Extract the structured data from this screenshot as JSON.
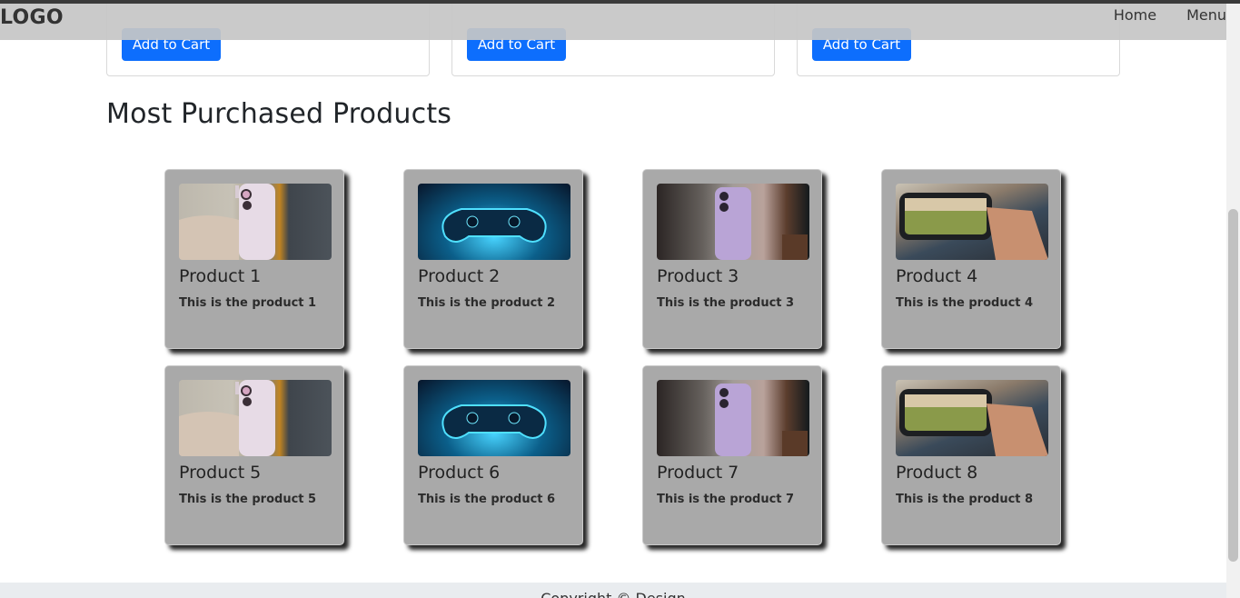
{
  "navbar": {
    "logo": "LOGO",
    "links": [
      "Home",
      "Menu"
    ]
  },
  "previous_cards": {
    "button_label": "Add to Cart"
  },
  "section": {
    "title": "Most Purchased Products"
  },
  "products": [
    {
      "name": "Product 1",
      "description": "This is the product 1",
      "image": "phone-hand-image"
    },
    {
      "name": "Product 2",
      "description": "This is the product 2",
      "image": "gamepad-image"
    },
    {
      "name": "Product 3",
      "description": "This is the product 3",
      "image": "phone-desk-image"
    },
    {
      "name": "Product 4",
      "description": "This is the product 4",
      "image": "phone-camera-landscape-image"
    },
    {
      "name": "Product 5",
      "description": "This is the product 5",
      "image": "phone-hand-image"
    },
    {
      "name": "Product 6",
      "description": "This is the product 6",
      "image": "gamepad-image"
    },
    {
      "name": "Product 7",
      "description": "This is the product 7",
      "image": "phone-desk-image"
    },
    {
      "name": "Product 8",
      "description": "This is the product 8",
      "image": "phone-camera-landscape-image"
    }
  ],
  "footer": {
    "text": "Copyright © Design"
  },
  "colors": {
    "accent": "#0d6efd",
    "card_bg": "#a9a9a9",
    "navbar_bg": "#c6c6c6"
  }
}
